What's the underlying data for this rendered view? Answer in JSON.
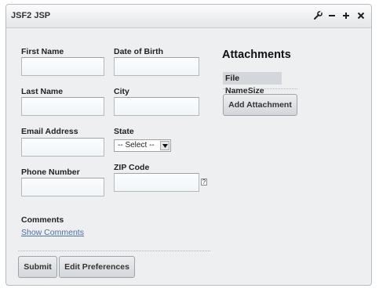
{
  "window": {
    "title": "JSF2 JSP",
    "icons": [
      "wrench-icon",
      "minimize-icon",
      "maximize-icon",
      "close-icon"
    ]
  },
  "form": {
    "first_name": {
      "label": "First Name",
      "value": ""
    },
    "date_of_birth": {
      "label": "Date of Birth",
      "value": ""
    },
    "last_name": {
      "label": "Last Name",
      "value": ""
    },
    "city": {
      "label": "City",
      "value": ""
    },
    "email": {
      "label": "Email Address",
      "value": ""
    },
    "state": {
      "label": "State",
      "selected": "-- Select --"
    },
    "phone": {
      "label": "Phone Number",
      "value": ""
    },
    "zip": {
      "label": "ZIP Code",
      "value": "",
      "help_icon": "?"
    },
    "comments": {
      "label": "Comments",
      "toggle_link": "Show Comments"
    },
    "submit_label": "Submit",
    "edit_preferences_label": "Edit Preferences"
  },
  "attachments": {
    "heading": "Attachments",
    "columns": [
      "File Name",
      "Size"
    ],
    "add_label": "Add Attachment"
  }
}
